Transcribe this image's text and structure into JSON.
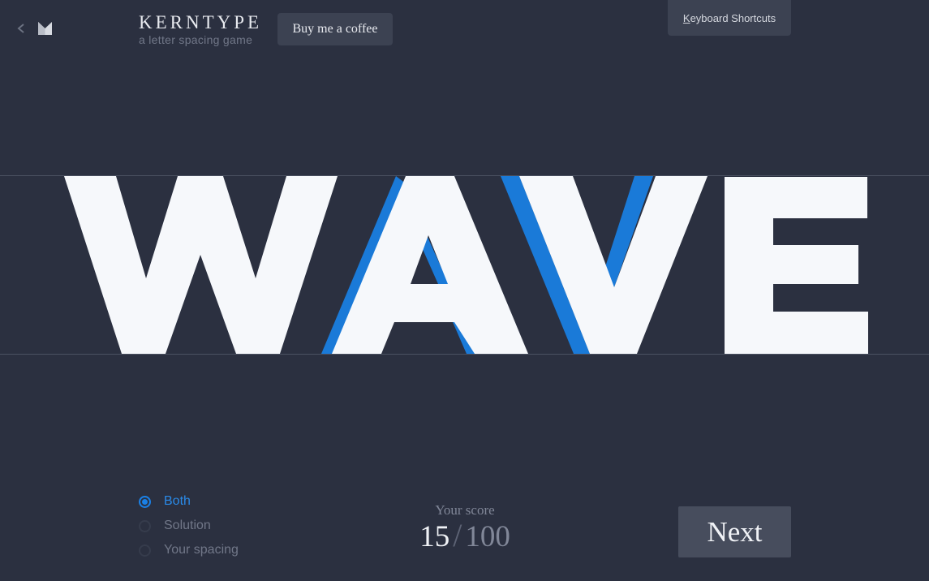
{
  "header": {
    "title": "KERNTYPE",
    "subtitle": "a letter spacing game",
    "coffee_label": "Buy me a coffee",
    "shortcuts_label_first": "K",
    "shortcuts_label_rest": "eyboard Shortcuts"
  },
  "icons": {
    "back": "chevron-left-icon",
    "logo": "method-logo-icon"
  },
  "word": {
    "letters": [
      "W",
      "A",
      "V",
      "E"
    ],
    "solution_color": "#1a7ad8",
    "letter_color": "#f6f8fb"
  },
  "view_options": {
    "selected": "Both",
    "items": [
      {
        "label": "Both"
      },
      {
        "label": "Solution"
      },
      {
        "label": "Your spacing"
      }
    ]
  },
  "score": {
    "label": "Your score",
    "value": "15",
    "separator": "/",
    "max": "100"
  },
  "next_label": "Next",
  "colors": {
    "background": "#2b3040",
    "accent": "#1a80e6"
  }
}
